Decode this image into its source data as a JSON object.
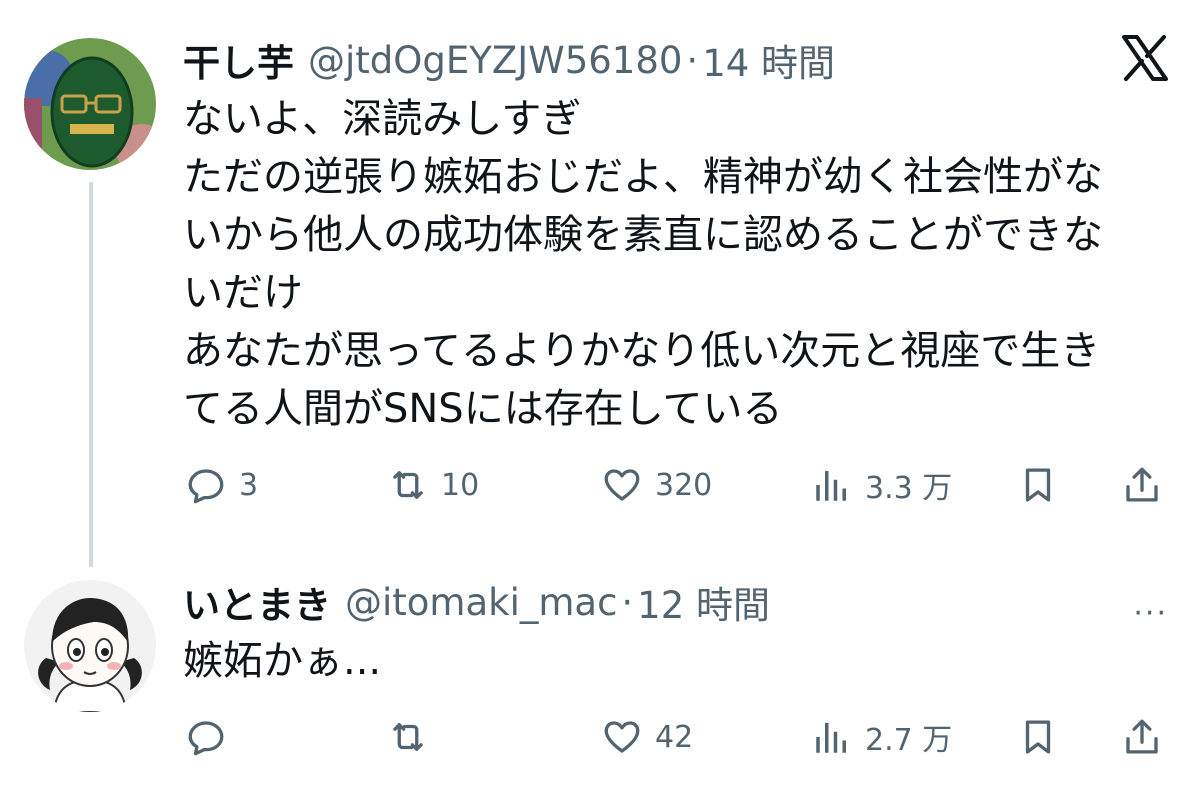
{
  "tweets": [
    {
      "display_name": "干し芋",
      "handle": "@jtdOgEYZJW56180",
      "separator": "·",
      "time": "14 時間",
      "lines": [
        "ないよ、深読みしすぎ",
        "ただの逆張り嫉妬おじだよ、精神が幼く社会性がな",
        "いから他人の成功体験を素直に認めることができな",
        "いだけ",
        "あなたが思ってるよりかなり低い次元と視座で生き",
        "てる人間がSNSには存在している"
      ],
      "stats": {
        "replies": "3",
        "retweets": "10",
        "likes": "320",
        "views": "3.3 万"
      },
      "corner_icon": "x-logo-icon",
      "avatar_icon": "avatar-green-mask"
    },
    {
      "display_name": "いとまき",
      "handle": "@itomaki_mac",
      "separator": "·",
      "time": "12 時間",
      "lines": [
        "嫉妬かぁ..."
      ],
      "stats": {
        "replies": "",
        "retweets": "",
        "likes": "42",
        "views": "2.7 万"
      },
      "corner_icon": "more-icon",
      "more_glyph": "···",
      "avatar_icon": "avatar-manga-girl"
    }
  ],
  "colors": {
    "text": "#0f1419",
    "secondary": "#536471",
    "thread_line": "#cfd9de"
  }
}
